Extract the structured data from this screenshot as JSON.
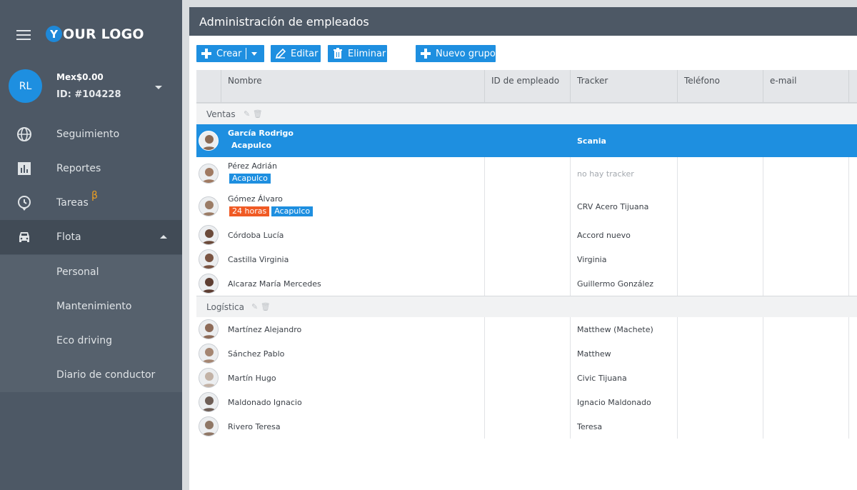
{
  "sidebar": {
    "logo_letter": "Y",
    "logo_text": "OUR LOGO",
    "avatar_initials": "RL",
    "balance": "Mex$0.00",
    "account_id": "ID: #104228",
    "nav": [
      {
        "label": "Seguimiento",
        "icon": "globe-icon"
      },
      {
        "label": "Reportes",
        "icon": "bar-chart-icon"
      },
      {
        "label": "Tareas",
        "icon": "clock-icon",
        "badge": "β"
      },
      {
        "label": "Flota",
        "icon": "car-icon"
      }
    ],
    "submenu": [
      "Personal",
      "Mantenimiento",
      "Eco driving",
      "Diario de conductor"
    ]
  },
  "header": {
    "title": "Administración de empleados"
  },
  "toolbar": {
    "create_label": "Crear",
    "edit_label": "Editar",
    "delete_label": "Eliminar",
    "new_group_label": "Nuevo grupo"
  },
  "table": {
    "columns": [
      "Nombre",
      "ID de empleado",
      "Tracker",
      "Teléfono",
      "e-mail"
    ],
    "groups": [
      {
        "name": "Ventas",
        "rows": [
          {
            "name": "García Rodrigo",
            "tags": [
              "Acapulco"
            ],
            "tracker": "Scania",
            "selected": true
          },
          {
            "name": "Pérez Adrián",
            "tags": [
              "Acapulco"
            ],
            "tracker": "no hay tracker"
          },
          {
            "name": "Gómez Álvaro",
            "tags": [
              "24 horas",
              "Acapulco"
            ],
            "tracker": "CRV Acero Tijuana"
          },
          {
            "name": "Córdoba Lucía",
            "tags": [],
            "tracker": "Accord nuevo"
          },
          {
            "name": "Castilla Virginia",
            "tags": [],
            "tracker": "Virginia"
          },
          {
            "name": "Alcaraz María Mercedes",
            "tags": [],
            "tracker": "Guillermo González"
          }
        ]
      },
      {
        "name": "Logística",
        "rows": [
          {
            "name": "Martínez Alejandro",
            "tags": [],
            "tracker": "Matthew (Machete)"
          },
          {
            "name": "Sánchez Pablo",
            "tags": [],
            "tracker": "Matthew"
          },
          {
            "name": "Martín Hugo",
            "tags": [],
            "tracker": "Civic Tijuana"
          },
          {
            "name": "Maldonado Ignacio",
            "tags": [],
            "tracker": "Ignacio Maldonado"
          },
          {
            "name": "Rivero Teresa",
            "tags": [],
            "tracker": "Teresa"
          }
        ]
      }
    ]
  },
  "colors": {
    "accent": "#1e8fe0",
    "sidebar": "#4d5865",
    "tag_orange": "#f05a24"
  }
}
